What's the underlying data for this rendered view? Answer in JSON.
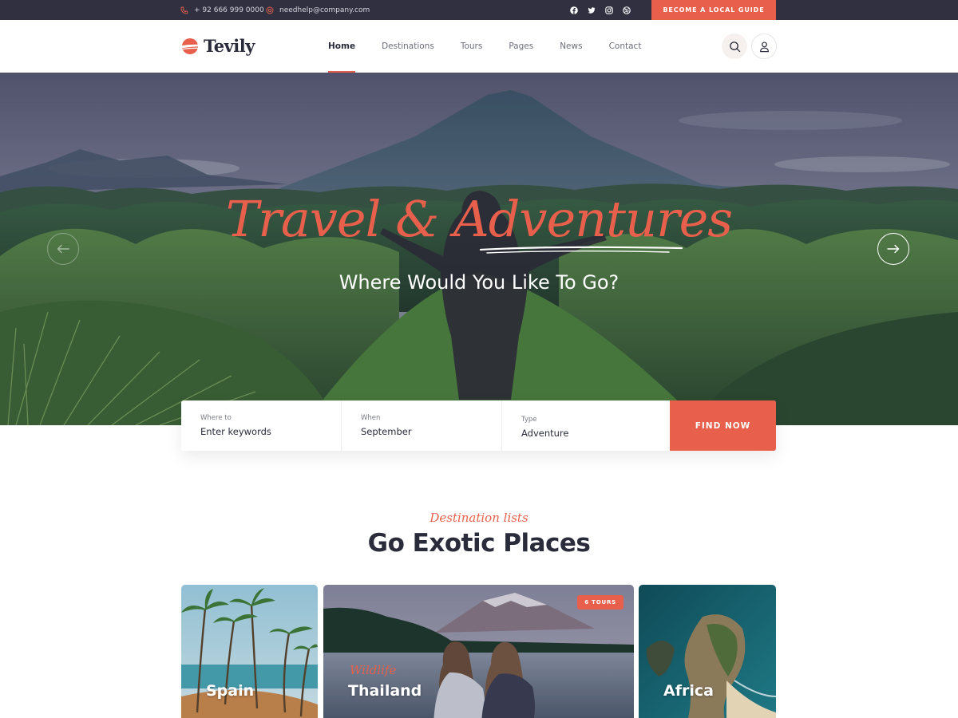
{
  "topbar": {
    "phone": "+ 92 666 999 0000",
    "email": "needhelp@company.com",
    "socials": [
      "facebook-icon",
      "twitter-icon",
      "instagram-icon",
      "dribbble-icon"
    ],
    "guide_button": "BECOME A LOCAL GUIDE"
  },
  "header": {
    "brand": "Tevily",
    "nav": [
      {
        "label": "Home",
        "active": true
      },
      {
        "label": "Destinations",
        "active": false
      },
      {
        "label": "Tours",
        "active": false
      },
      {
        "label": "Pages",
        "active": false
      },
      {
        "label": "News",
        "active": false
      },
      {
        "label": "Contact",
        "active": false
      }
    ]
  },
  "hero": {
    "script_title": "Travel & Adventures",
    "subtitle": "Where Would You Like To Go?"
  },
  "search": {
    "where_label": "Where to",
    "where_value": "Enter keywords",
    "when_label": "When",
    "when_value": "September",
    "type_label": "Type",
    "type_value": "Adventure",
    "button": "FIND NOW"
  },
  "section": {
    "tagline": "Destination lists",
    "title": "Go Exotic Places"
  },
  "destinations": [
    {
      "name": "Spain"
    },
    {
      "name": "Thailand",
      "badge": "6 TOURS",
      "script": "Wildlife"
    },
    {
      "name": "Africa"
    }
  ],
  "colors": {
    "accent": "#e8604c",
    "dark": "#313041",
    "text": "#2a2c3b"
  }
}
